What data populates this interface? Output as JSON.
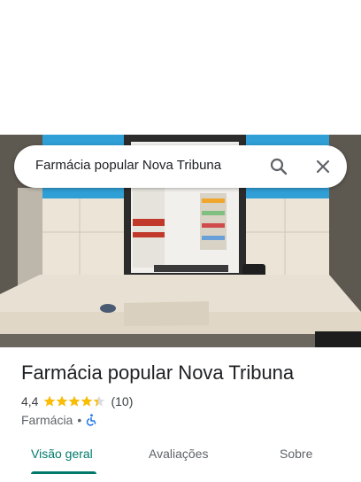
{
  "search": {
    "query": "Farmácia popular Nova Tribuna"
  },
  "place": {
    "name": "Farmácia popular Nova Tribuna",
    "rating": "4,4",
    "stars": 4.4,
    "review_count": "(10)",
    "category": "Farmácia",
    "separator": "•"
  },
  "tabs": [
    {
      "label": "Visão geral",
      "active": true
    },
    {
      "label": "Avaliações",
      "active": false
    },
    {
      "label": "Sobre",
      "active": false
    }
  ],
  "colors": {
    "accent": "#00796b",
    "star": "#fbbc04",
    "wheelchair": "#1a73e8"
  },
  "icons": [
    "search-icon",
    "close-icon",
    "star-icon",
    "wheelchair-icon"
  ]
}
